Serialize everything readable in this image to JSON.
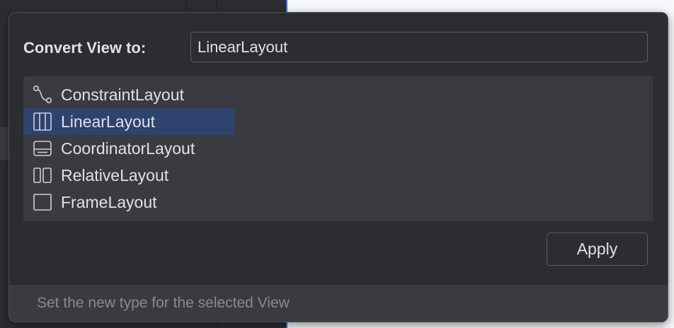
{
  "dialog": {
    "title_label": "Convert View to:",
    "search": {
      "value": "LinearLayout",
      "placeholder": ""
    },
    "items": [
      {
        "label": "ConstraintLayout",
        "icon": "constraint-layout-icon",
        "selected": false
      },
      {
        "label": "LinearLayout",
        "icon": "linear-layout-icon",
        "selected": true
      },
      {
        "label": "CoordinatorLayout",
        "icon": "coordinator-layout-icon",
        "selected": false
      },
      {
        "label": "RelativeLayout",
        "icon": "relative-layout-icon",
        "selected": false
      },
      {
        "label": "FrameLayout",
        "icon": "frame-layout-icon",
        "selected": false
      }
    ],
    "apply_label": "Apply",
    "footer_hint": "Set the new type for the selected View"
  },
  "colors": {
    "popup_bg": "#2b2d30",
    "list_bg": "#393b40",
    "selection": "#2e436e",
    "text": "#dfe1e5",
    "hint_text": "#868a91",
    "accent": "#3574f0"
  }
}
